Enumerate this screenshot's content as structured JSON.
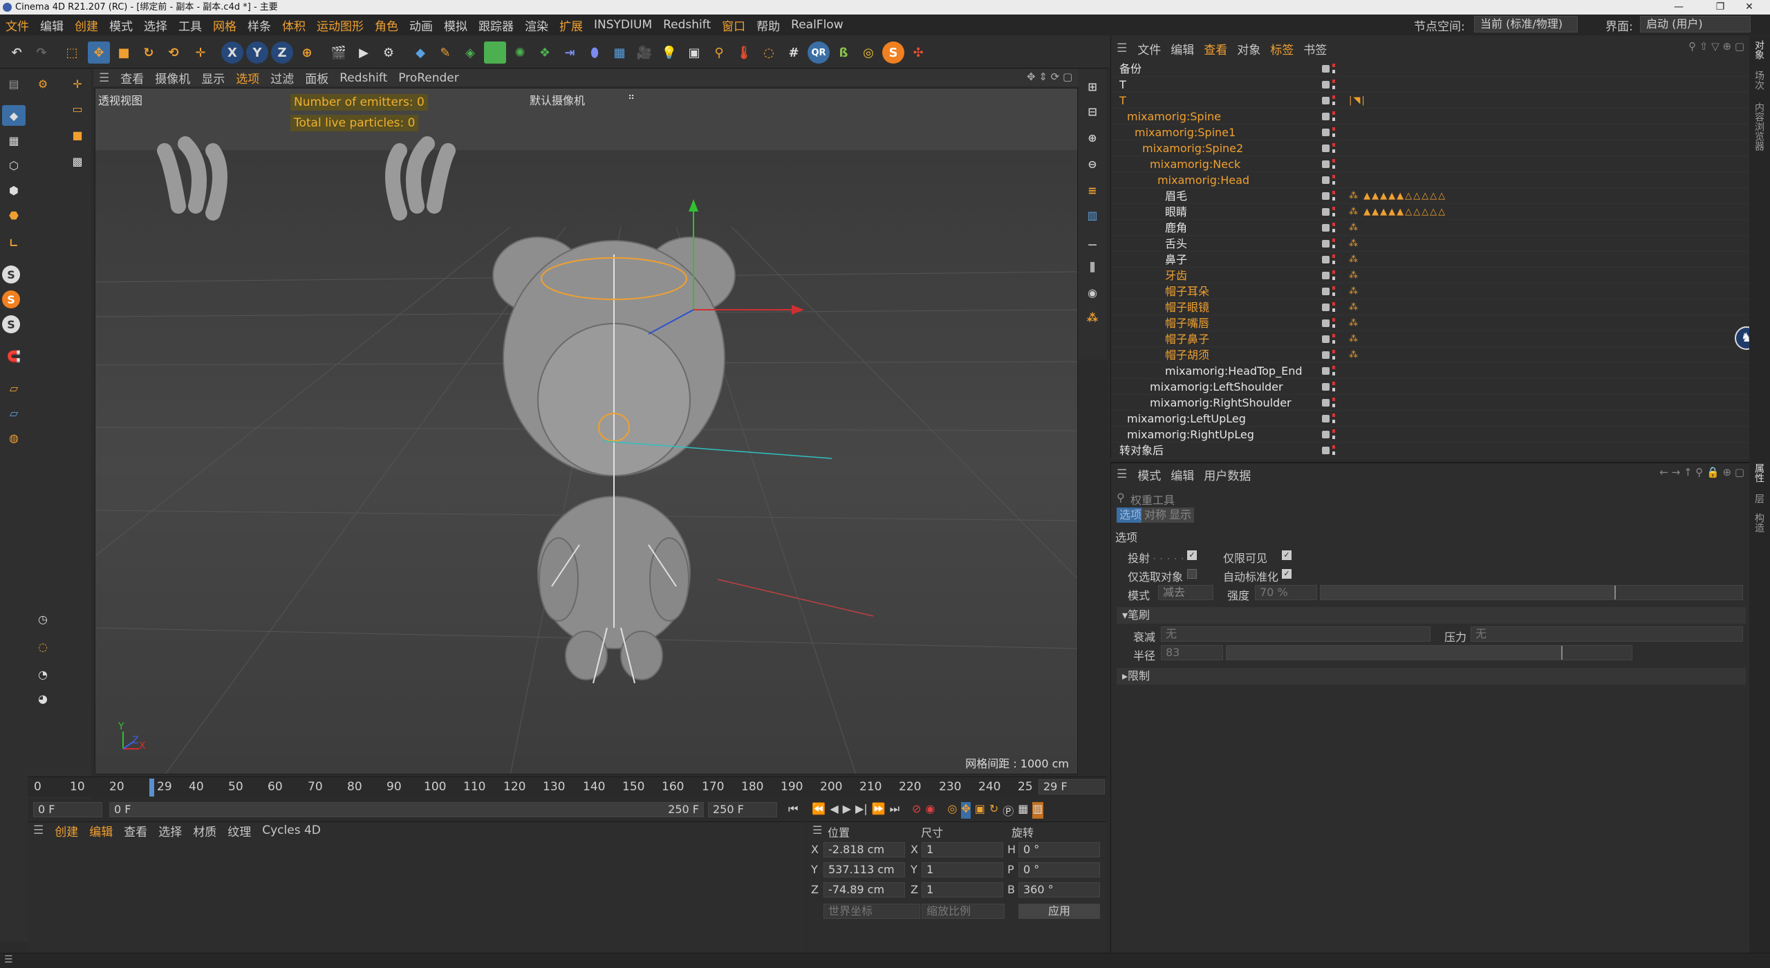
{
  "window": {
    "title": "Cinema 4D R21.207 (RC) - [绑定前 - 副本 - 副本.c4d *] - 主要",
    "controls": [
      "—",
      "❐",
      "✕"
    ]
  },
  "menu": [
    "文件",
    "编辑",
    "创建",
    "模式",
    "选择",
    "工具",
    "网格",
    "样条",
    "体积",
    "运动图形",
    "角色",
    "动画",
    "模拟",
    "跟踪器",
    "渲染",
    "扩展",
    "INSYDIUM",
    "Redshift",
    "窗口",
    "帮助",
    "RealFlow"
  ],
  "menu_right": {
    "node_space_label": "节点空间:",
    "node_space_value": "当前 (标准/物理)",
    "layout_label": "界面:",
    "layout_value": "启动 (用户)"
  },
  "toolbar": {
    "axis_buttons": [
      "X",
      "Y",
      "Z"
    ]
  },
  "viewport": {
    "menu": [
      "查看",
      "摄像机",
      "显示",
      "选项",
      "过滤",
      "面板",
      "Redshift",
      "ProRender"
    ],
    "title": "透视视图",
    "camera": "默认摄像机",
    "emitters_text": "Number of emitters: 0",
    "particles_text": "Total live particles: 0",
    "grid_spacing": "网格间距 : 1000 cm",
    "axis_y": "Y",
    "axis_z": "Z",
    "axis_x": "X"
  },
  "timeline": {
    "ticks": [
      "0",
      "10",
      "20",
      "29",
      "40",
      "50",
      "60",
      "70",
      "80",
      "90",
      "100",
      "110",
      "120",
      "130",
      "140",
      "150",
      "160",
      "170",
      "180",
      "190",
      "200",
      "210",
      "220",
      "230",
      "240",
      "25"
    ],
    "current_frame": "29 F",
    "start": "0 F",
    "range_start": "0 F",
    "range_end": "250 F",
    "end": "250 F"
  },
  "material_manager": {
    "menu": [
      "创建",
      "编辑",
      "查看",
      "选择",
      "材质",
      "纹理",
      "Cycles 4D"
    ]
  },
  "coordinates": {
    "headers": [
      "位置",
      "尺寸",
      "旋转"
    ],
    "rows": [
      {
        "axis": "X",
        "pos": "-2.818 cm",
        "size_axis": "X",
        "size": "1",
        "rot_axis": "H",
        "rot": "0 °"
      },
      {
        "axis": "Y",
        "pos": "537.113 cm",
        "size_axis": "Y",
        "size": "1",
        "rot_axis": "P",
        "rot": "0 °"
      },
      {
        "axis": "Z",
        "pos": "-74.89 cm",
        "size_axis": "Z",
        "size": "1",
        "rot_axis": "B",
        "rot": "360 °"
      }
    ],
    "coord_mode": "世界坐标",
    "scale_mode": "缩放比例",
    "apply": "应用"
  },
  "object_manager": {
    "menu": [
      "文件",
      "编辑",
      "查看",
      "对象",
      "标签",
      "书签"
    ],
    "objects": [
      {
        "name": "备份",
        "depth": 0,
        "color": "white",
        "tags": ""
      },
      {
        "name": "T",
        "depth": 0,
        "color": "white",
        "tags": ""
      },
      {
        "name": "T",
        "depth": 0,
        "color": "orange",
        "tags": "|◥|"
      },
      {
        "name": "mixamorig:Spine",
        "depth": 1,
        "color": "orange",
        "tags": ""
      },
      {
        "name": "mixamorig:Spine1",
        "depth": 2,
        "color": "orange",
        "tags": ""
      },
      {
        "name": "mixamorig:Spine2",
        "depth": 3,
        "color": "orange",
        "tags": ""
      },
      {
        "name": "mixamorig:Neck",
        "depth": 4,
        "color": "orange",
        "tags": ""
      },
      {
        "name": "mixamorig:Head",
        "depth": 5,
        "color": "orange",
        "tags": ""
      },
      {
        "name": "眉毛",
        "depth": 6,
        "color": "white",
        "tags": "⁂ ▲▲▲▲▲△△△△△"
      },
      {
        "name": "眼睛",
        "depth": 6,
        "color": "white",
        "tags": "⁂ ▲▲▲▲▲△△△△△"
      },
      {
        "name": "鹿角",
        "depth": 6,
        "color": "white",
        "tags": "⁂"
      },
      {
        "name": "舌头",
        "depth": 6,
        "color": "white",
        "tags": "⁂"
      },
      {
        "name": "鼻子",
        "depth": 6,
        "color": "white",
        "tags": "⁂"
      },
      {
        "name": "牙齿",
        "depth": 6,
        "color": "orange",
        "tags": "⁂"
      },
      {
        "name": "帽子耳朵",
        "depth": 6,
        "color": "orange",
        "tags": "⁂"
      },
      {
        "name": "帽子眼镜",
        "depth": 6,
        "color": "orange",
        "tags": "⁂"
      },
      {
        "name": "帽子嘴唇",
        "depth": 6,
        "color": "orange",
        "tags": "⁂"
      },
      {
        "name": "帽子鼻子",
        "depth": 6,
        "color": "orange",
        "tags": "⁂"
      },
      {
        "name": "帽子胡须",
        "depth": 6,
        "color": "orange",
        "tags": "⁂"
      },
      {
        "name": "mixamorig:HeadTop_End",
        "depth": 6,
        "color": "white",
        "tags": ""
      },
      {
        "name": "mixamorig:LeftShoulder",
        "depth": 4,
        "color": "white",
        "tags": ""
      },
      {
        "name": "mixamorig:RightShoulder",
        "depth": 4,
        "color": "white",
        "tags": ""
      },
      {
        "name": "mixamorig:LeftUpLeg",
        "depth": 1,
        "color": "white",
        "tags": ""
      },
      {
        "name": "mixamorig:RightUpLeg",
        "depth": 1,
        "color": "white",
        "tags": ""
      },
      {
        "name": "转对象后",
        "depth": 0,
        "color": "white",
        "tags": ""
      }
    ]
  },
  "attributes": {
    "menu": [
      "模式",
      "编辑",
      "用户数据"
    ],
    "tool_name": "权重工具",
    "tabs": [
      "选项",
      "对称",
      "显示"
    ],
    "section_options": "选项",
    "projection": "投射",
    "visible_only": "仅限可见",
    "selected_only": "仅选取对象",
    "auto_normalize": "自动标准化",
    "mode_label": "模式",
    "mode_value": "减去",
    "strength_label": "强度",
    "strength_value": "70 %",
    "strength_fraction": 0.7,
    "brush_section": "笔刷",
    "falloff_label": "衰减",
    "falloff_value": "无",
    "pressure_label": "压力",
    "pressure_value": "无",
    "radius_label": "半径",
    "radius_value": "83",
    "radius_fraction": 0.83,
    "limit_section": "限制"
  },
  "right_tabs": [
    "对象",
    "场次",
    "内容浏览器",
    "属性",
    "层",
    "构造"
  ],
  "colors": {
    "accent": "#f0a030",
    "bg": "#2d2d2d",
    "viewport": "#444444",
    "selection_blue": "#3a6ea5"
  }
}
